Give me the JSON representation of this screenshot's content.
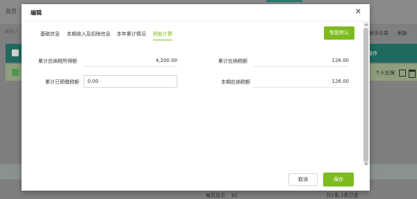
{
  "background": {
    "home_tab": "首页",
    "subrow_text": "填报人: 2…",
    "guide_link": "新手引导",
    "refresh_link": "刷新",
    "table_header_op": "操作",
    "row_social_security": "个人社保",
    "pager": {
      "total_pages_text": "每页显示",
      "page_size": "10",
      "total_text": "共1条,1条已选"
    }
  },
  "modal": {
    "title": "编辑",
    "tabs": [
      {
        "label": "基础信息",
        "active": false
      },
      {
        "label": "本期收入及扣除信息",
        "active": false
      },
      {
        "label": "本年累计情况",
        "active": false
      },
      {
        "label": "税款计算",
        "active": true
      }
    ],
    "reset_button": "恢复默认",
    "fields": {
      "cumulative_taxable_income": {
        "label": "累计应纳税所得额",
        "value": "4,200.00"
      },
      "cumulative_tax_payable": {
        "label": "累计应纳税额",
        "value": "126.00"
      },
      "cumulative_prepaid_tax": {
        "label": "累计已预缴税额",
        "value": "0.00"
      },
      "current_tax_payable": {
        "label": "本期应纳税额",
        "value": "126.00"
      }
    },
    "buttons": {
      "cancel": "取消",
      "save": "保存"
    }
  },
  "colors": {
    "accent": "#7dbb1e",
    "header_teal": "#1f6a5f"
  }
}
